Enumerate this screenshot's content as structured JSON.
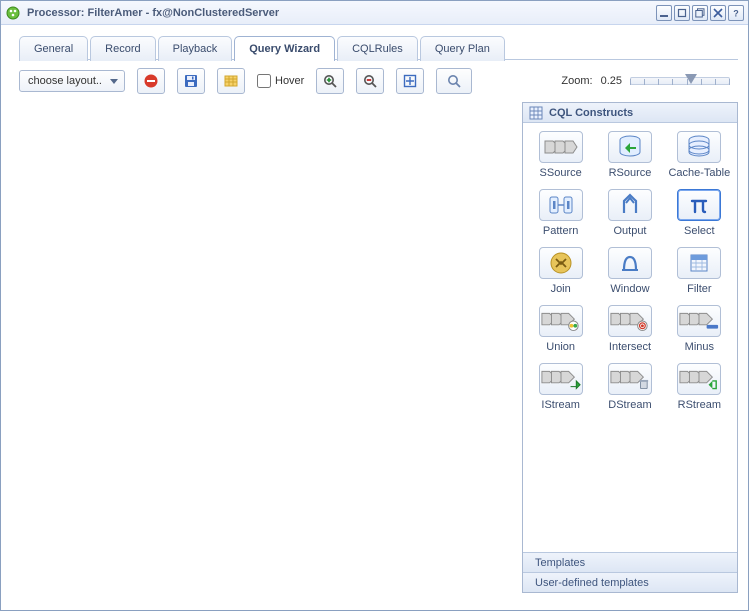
{
  "window": {
    "title": "Processor: FilterAmer - fx@NonClusteredServer"
  },
  "tabs": [
    {
      "label": "General"
    },
    {
      "label": "Record"
    },
    {
      "label": "Playback"
    },
    {
      "label": "Query Wizard"
    },
    {
      "label": "CQLRules"
    },
    {
      "label": "Query Plan"
    }
  ],
  "toolbar": {
    "layout_dropdown": "choose layout..",
    "hover_label": "Hover",
    "zoom_label": "Zoom:",
    "zoom_value": "0.25"
  },
  "palette": {
    "constructs_head": "CQL Constructs",
    "items": [
      {
        "label": "SSource"
      },
      {
        "label": "RSource"
      },
      {
        "label": "Cache-Table"
      },
      {
        "label": "Pattern"
      },
      {
        "label": "Output"
      },
      {
        "label": "Select"
      },
      {
        "label": "Join"
      },
      {
        "label": "Window"
      },
      {
        "label": "Filter"
      },
      {
        "label": "Union"
      },
      {
        "label": "Intersect"
      },
      {
        "label": "Minus"
      },
      {
        "label": "IStream"
      },
      {
        "label": "DStream"
      },
      {
        "label": "RStream"
      }
    ],
    "templates_head": "Templates",
    "userdef_head": "User-defined templates"
  }
}
